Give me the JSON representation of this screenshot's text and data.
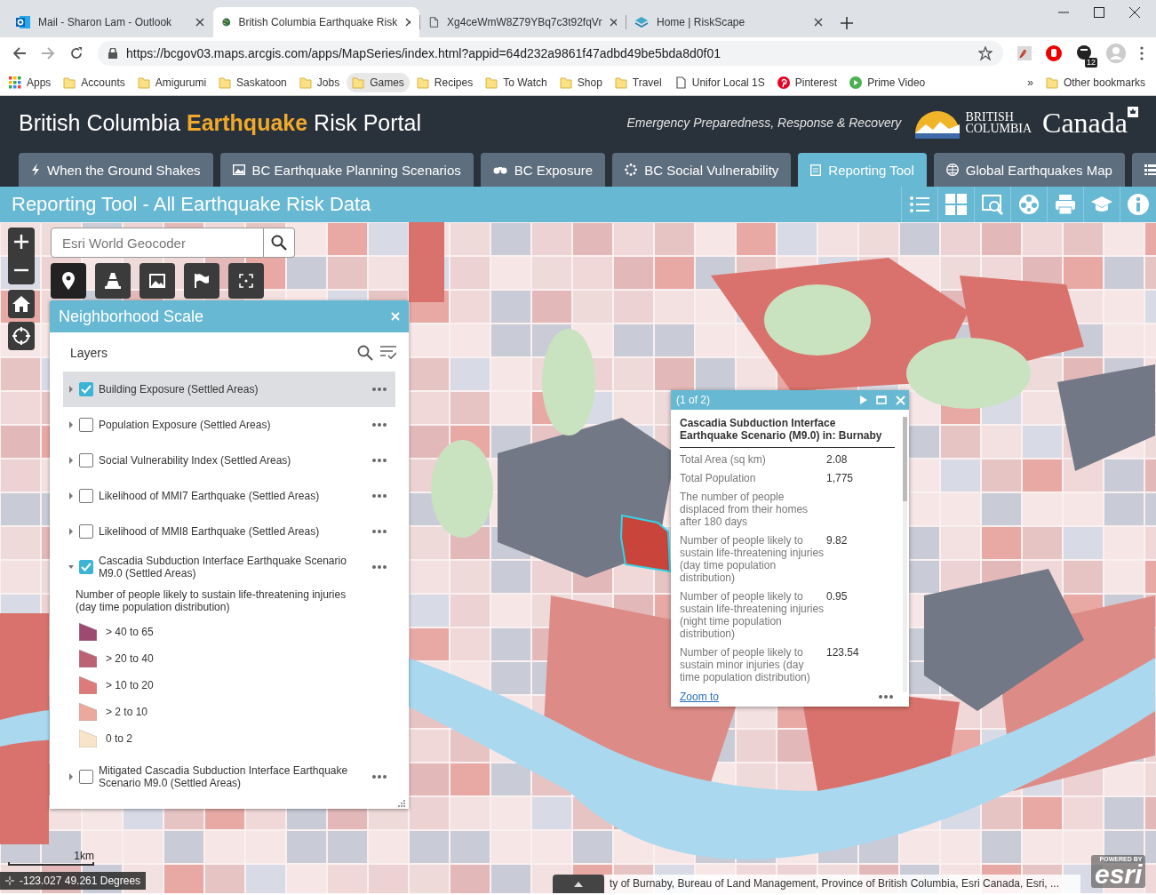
{
  "browser": {
    "tabs": [
      {
        "title": "Mail - Sharon Lam - Outlook",
        "kind": "mail",
        "selected": false
      },
      {
        "title": "British Columbia Earthquake Risk",
        "kind": "globe",
        "selected": true
      },
      {
        "title": "Xg4ceWmW8Z79YBq7c3t92fqVr",
        "kind": "page",
        "selected": false
      },
      {
        "title": "Home | RiskScape",
        "kind": "layers",
        "selected": false
      }
    ],
    "address": "https://bcgov03.maps.arcgis.com/apps/MapSeries/index.html?appid=64d232a9861f47adbd49be5bda8d0f01",
    "extension_badge": "12",
    "bookmarks": [
      {
        "label": "Apps",
        "kind": "apps",
        "hovered": false
      },
      {
        "label": "Accounts",
        "kind": "folder",
        "hovered": false
      },
      {
        "label": "Amigurumi",
        "kind": "folder",
        "hovered": false
      },
      {
        "label": "Saskatoon",
        "kind": "folder",
        "hovered": false
      },
      {
        "label": "Jobs",
        "kind": "folder",
        "hovered": false
      },
      {
        "label": "Games",
        "kind": "folder",
        "hovered": true
      },
      {
        "label": "Recipes",
        "kind": "folder",
        "hovered": false
      },
      {
        "label": "To Watch",
        "kind": "folder",
        "hovered": false
      },
      {
        "label": "Shop",
        "kind": "folder",
        "hovered": false
      },
      {
        "label": "Travel",
        "kind": "folder",
        "hovered": false
      },
      {
        "label": "Unifor Local 1S",
        "kind": "page",
        "hovered": false
      },
      {
        "label": "Pinterest",
        "kind": "pin",
        "hovered": false
      },
      {
        "label": "Prime Video",
        "kind": "play",
        "hovered": false
      }
    ],
    "more": "»",
    "other_bookmarks": "Other bookmarks"
  },
  "portal": {
    "title": "British Columbia **Earthquake** Risk Portal",
    "subtitle": "Emergency Preparedness, Response & Recovery",
    "bc_logo": [
      "BRITISH",
      "COLUMBIA"
    ],
    "canada": "Canada",
    "tabs": [
      {
        "label": "When the Ground Shakes",
        "selected": false
      },
      {
        "label": "BC Earthquake Planning Scenarios",
        "selected": false
      },
      {
        "label": "BC Exposure",
        "selected": false
      },
      {
        "label": "BC Social Vulnerability",
        "selected": false
      },
      {
        "label": "Reporting Tool",
        "selected": true
      },
      {
        "label": "Global Earthquakes Map",
        "selected": false
      }
    ],
    "page_title": "Reporting Tool - All Earthquake Risk Data"
  },
  "map": {
    "search": {
      "placeholder": "Esri World Geocoder"
    },
    "scale": "1km",
    "coordinates": "-123.027 49.261 Degrees",
    "attribution_expanded": false,
    "attribution": "ty of Burnaby, Bureau of Land Management, Province of British Columbia, Esri Canada, Esri, ...",
    "esri": {
      "powered_by": "POWERED BY",
      "logo": "esri"
    }
  },
  "panel": {
    "title": "Neighborhood Scale",
    "heading": "Layers",
    "layers": [
      {
        "label": "Building Exposure (Settled Areas)",
        "checked": true,
        "selected": true,
        "expanded": false
      },
      {
        "label": "Population Exposure (Settled Areas)",
        "checked": false,
        "selected": false,
        "expanded": false
      },
      {
        "label": "Social Vulnerability Index (Settled Areas)",
        "checked": false,
        "selected": false,
        "expanded": false
      },
      {
        "label": "Likelihood of MMI7 Earthquake (Settled Areas)",
        "checked": false,
        "selected": false,
        "expanded": false
      },
      {
        "label": "Likelihood of MMI8 Earthquake (Settled Areas)",
        "checked": false,
        "selected": false,
        "expanded": false
      },
      {
        "label": "Cascadia Subduction Interface Earthquake Scenario M9.0 (Settled Areas)",
        "checked": true,
        "selected": false,
        "expanded": true,
        "legend": {
          "title": "Number of people likely to sustain life-threatening injuries (day time population distribution)",
          "items": [
            {
              "label": "> 40 to 65",
              "color": "#9c4a70"
            },
            {
              "label": "> 20 to 40",
              "color": "#bb6275"
            },
            {
              "label": "> 10 to 20",
              "color": "#dc7b7a"
            },
            {
              "label": "> 2 to 10",
              "color": "#eaa99c"
            },
            {
              "label": "0 to 2",
              "color": "#f8e4c6"
            }
          ]
        }
      },
      {
        "label": "Mitigated Cascadia Subduction Interface Earthquake Scenario M9.0 (Settled Areas)",
        "checked": false,
        "selected": false,
        "expanded": false
      }
    ]
  },
  "popup": {
    "counter": "(1 of 2)",
    "title": "Cascadia Subduction Interface Earthquake Scenario (M9.0) in: Burnaby",
    "fields": [
      {
        "label": "Total Area (sq km)",
        "value": "2.08"
      },
      {
        "label": "Total Population",
        "value": "1,775"
      },
      {
        "label": "The number of people displaced from their homes after 180 days"
      },
      {
        "label": "Number of people likely to sustain life-threatening injuries (day time population distribution)",
        "value": "9.82"
      },
      {
        "label": "Number of people likely to sustain life-threatening injuries (night time population distribution)",
        "value": "0.95"
      },
      {
        "label": "Number of people likely to sustain minor injuries (day time population distribution)",
        "value": "123.54"
      }
    ],
    "link": "Zoom to"
  }
}
